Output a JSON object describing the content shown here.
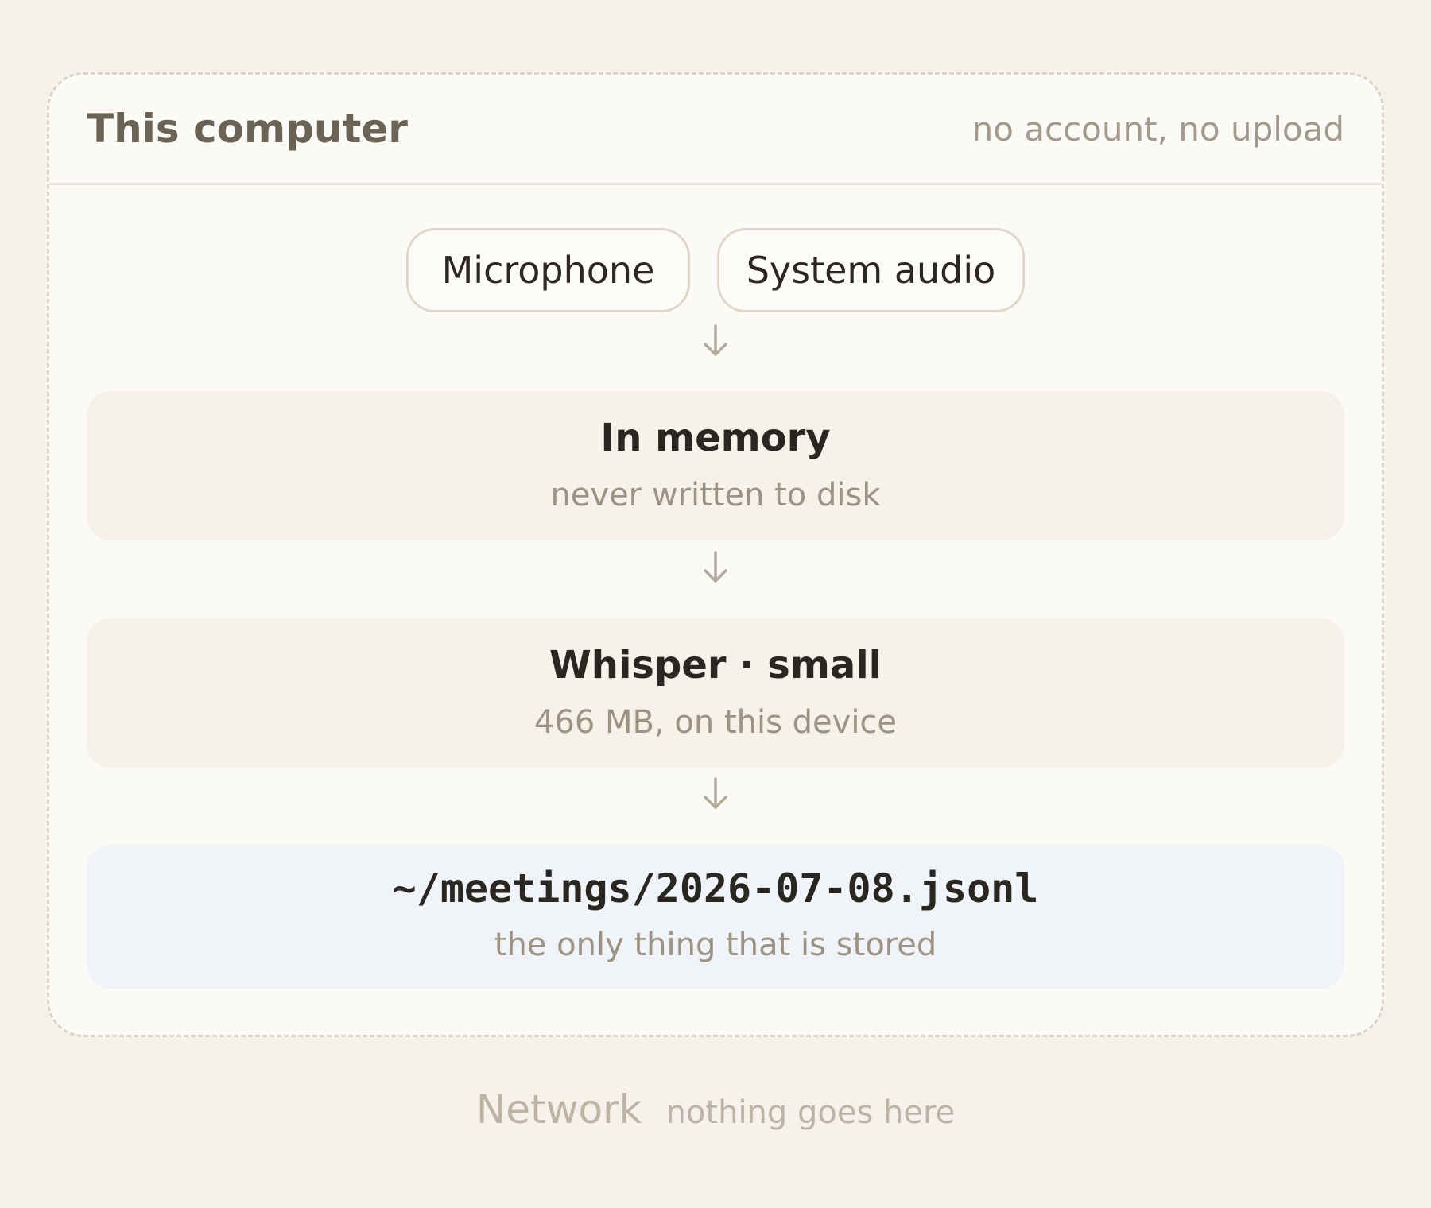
{
  "boundary": {
    "title": "This computer",
    "note": "no account, no upload"
  },
  "sources": [
    {
      "label": "Microphone"
    },
    {
      "label": "System audio"
    }
  ],
  "stages": [
    {
      "title": "In memory",
      "subtitle": "never written to disk"
    },
    {
      "title": "Whisper · small",
      "subtitle": "466 MB, on this device"
    },
    {
      "title": "~/meetings/2026-07-08.jsonl",
      "subtitle": "the only thing that is stored"
    }
  ],
  "network": {
    "label": "Network",
    "note": "nothing goes here"
  },
  "colors": {
    "page_background": "#f6f2eb",
    "boundary_background": "#fcfaf6",
    "boundary_border": "#ddd3c4",
    "stage_background": "#f6f1e9",
    "output_background": "#f0f3f8",
    "arrow": "#b3aa9c"
  },
  "icons": {
    "arrow": "arrow-down-icon"
  }
}
